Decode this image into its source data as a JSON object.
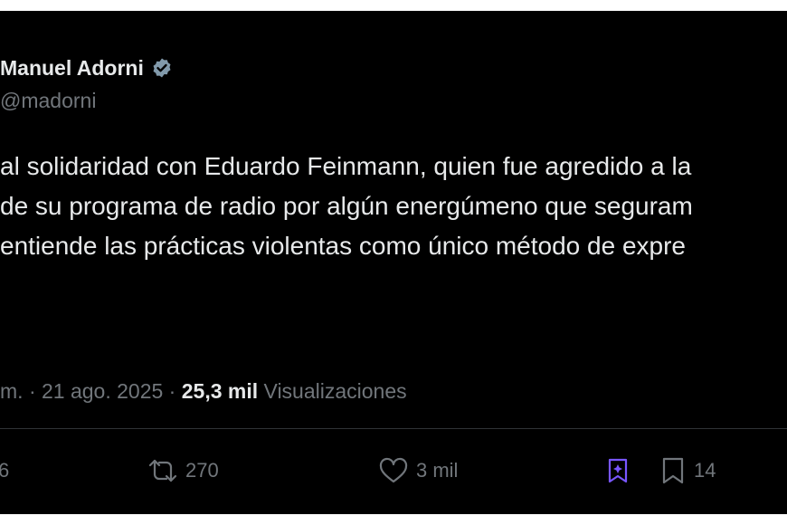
{
  "tweet": {
    "display_name": "Manuel Adorni",
    "handle": "@madorni",
    "text_lines": [
      "al solidaridad con Eduardo Feinmann, quien fue agredido a la",
      "de su programa de radio por algún energúmeno que seguram",
      "entiende las prácticas violentas como único método de expre"
    ],
    "time": "m. · 21 ago. 2025 · ",
    "views_count": "25,3 mil",
    "views_label": " Visualizaciones"
  },
  "actions": {
    "replies": "6",
    "reposts": "270",
    "likes": "3 mil",
    "bookmarks": "14"
  },
  "colors": {
    "background": "#000000",
    "text": "#e7e9ea",
    "muted": "#71767b",
    "verified_badge": "#829aab",
    "grok_accent": "#7856ff"
  },
  "icons": [
    "verified-badge-icon",
    "repost-icon",
    "heart-icon",
    "grok-icon",
    "bookmark-icon"
  ]
}
